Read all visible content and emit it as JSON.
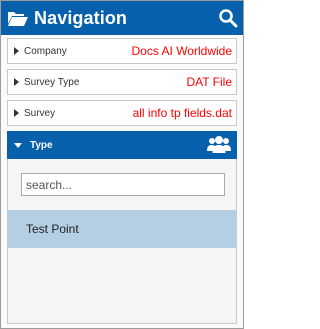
{
  "header": {
    "title": "Navigation",
    "folder_icon": "folder-open-icon",
    "search_icon": "search-icon",
    "background": "#0760ac"
  },
  "selectors": [
    {
      "label": "Company",
      "value": "Docs AI Worldwide",
      "icon": "caret-right-icon"
    },
    {
      "label": "Survey Type",
      "value": "DAT File",
      "icon": "caret-right-icon"
    },
    {
      "label": "Survey",
      "value": "all info tp fields.dat",
      "icon": "caret-right-icon"
    }
  ],
  "type_section": {
    "label": "Type",
    "caret_icon": "caret-down-icon",
    "users_icon": "users-icon",
    "search": {
      "placeholder": "search...",
      "value": ""
    },
    "items": [
      {
        "label": "Test Point",
        "selected": true
      }
    ]
  },
  "colors": {
    "accent": "#0760ac",
    "value_text": "#ff0000",
    "selected_row": "#b4cfe4"
  }
}
